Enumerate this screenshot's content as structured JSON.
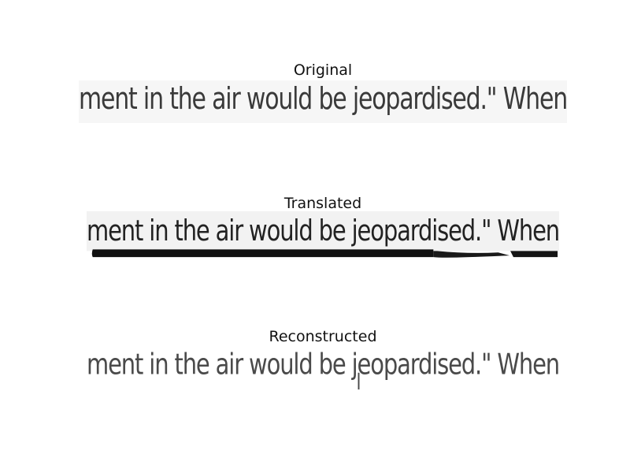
{
  "figure": {
    "panels": [
      {
        "title": "Original",
        "handwriting": "ment in the air would be jeopardised.\" When",
        "ink_color": "#3a3a3a",
        "background": "#f6f6f6"
      },
      {
        "title": "Translated",
        "handwriting": "ment in the air would be jeopardised.\" When",
        "ink_color": "#222222",
        "background": "#f2f2f2"
      },
      {
        "title": "Reconstructed",
        "handwriting": "ment in the air would be jeopardised.\" When",
        "ink_color": "#4a4a4a",
        "background": "#ffffff"
      }
    ]
  }
}
